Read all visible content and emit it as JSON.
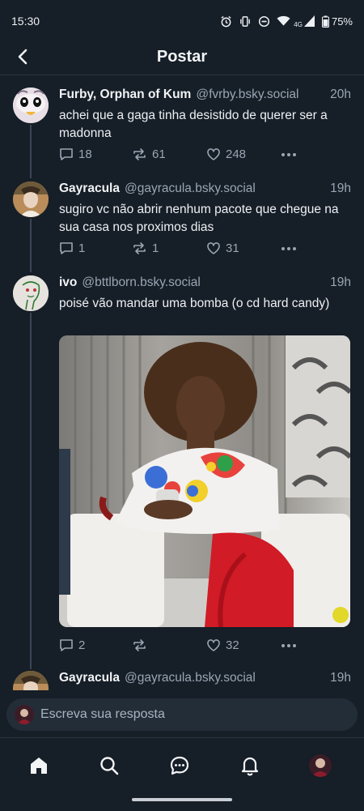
{
  "status": {
    "time": "15:30",
    "network": "4G",
    "battery": "75%"
  },
  "header": {
    "title": "Postar"
  },
  "posts": [
    {
      "name": "Furby, Orphan of Kum",
      "handle": "@fvrby.bsky.social",
      "time": "20h",
      "text": "achei que a gaga tinha desistido de querer ser a madonna",
      "replies": "18",
      "reposts": "61",
      "likes": "248"
    },
    {
      "name": "Gayracula",
      "handle": "@gayracula.bsky.social",
      "time": "19h",
      "text": "sugiro vc não abrir nenhum pacote que chegue na sua casa nos proximos dias",
      "replies": "1",
      "reposts": "1",
      "likes": "31"
    },
    {
      "name": "ivo",
      "handle": "@bttlborn.bsky.social",
      "time": "19h",
      "text": "poisé vão mandar uma bomba (o cd hard candy)",
      "replies": "2",
      "reposts": "",
      "likes": "32"
    },
    {
      "name": "Gayracula",
      "handle": "@gayracula.bsky.social",
      "time": "19h"
    }
  ],
  "reply": {
    "placeholder": "Escreva sua resposta"
  }
}
